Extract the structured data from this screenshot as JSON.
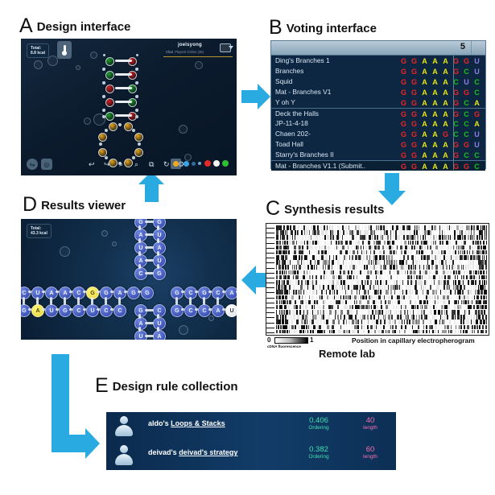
{
  "figure": {
    "panels": [
      {
        "id": "A",
        "letter": "A",
        "title": "Design interface"
      },
      {
        "id": "B",
        "letter": "B",
        "title": "Voting interface"
      },
      {
        "id": "C",
        "letter": "C",
        "title": "Synthesis results"
      },
      {
        "id": "D",
        "letter": "D",
        "title": "Results viewer"
      },
      {
        "id": "E",
        "letter": "E",
        "title": "Design rule collection"
      }
    ],
    "accent_color": "#29ABE2"
  },
  "design_interface": {
    "total_label": "Total:",
    "total_value": "8.8 kcal",
    "username": "joelsyong",
    "chat_label": "Chat",
    "players_online": "Players Online (36)",
    "thermometer_icon": "thermometer-icon",
    "toolbar": {
      "buttons": [
        {
          "name": "swap-button",
          "glyph": "⇋"
        },
        {
          "name": "camera-button",
          "glyph": "◎"
        },
        {
          "name": "undo-button",
          "glyph": "↩"
        },
        {
          "name": "redo-button",
          "glyph": "↪"
        },
        {
          "name": "zoom-in-button",
          "glyph": "⌕"
        },
        {
          "name": "zoom-out-button",
          "glyph": "⌕"
        },
        {
          "name": "screenshot-button",
          "glyph": "⧉"
        },
        {
          "name": "reset-button",
          "glyph": "↻"
        },
        {
          "name": "hint-button",
          "glyph": "⚙"
        }
      ],
      "palette_label": "base-palette"
    },
    "molecule": {
      "stem_pairs": [
        {
          "left": "C",
          "right": "G"
        },
        {
          "left": "C",
          "right": "G"
        },
        {
          "left": "G",
          "right": "C"
        },
        {
          "left": "G",
          "right": "C"
        },
        {
          "left": "C",
          "right": "G"
        }
      ],
      "loop_bases": [
        "A",
        "A",
        "A",
        "A",
        "A",
        "A",
        "A",
        "A"
      ]
    }
  },
  "voting_interface": {
    "column_header": "5",
    "rows": [
      {
        "name": "Ding's Branches 1",
        "seq": [
          "G",
          "G",
          "A",
          "A",
          "A",
          "G",
          "G",
          "U"
        ],
        "group": 1,
        "selected": false
      },
      {
        "name": "Branches",
        "seq": [
          "G",
          "G",
          "A",
          "A",
          "A",
          "G",
          "C",
          "U"
        ],
        "group": 1,
        "selected": false
      },
      {
        "name": "Squid",
        "seq": [
          "G",
          "G",
          "A",
          "A",
          "A",
          "C",
          "U",
          "C"
        ],
        "group": 1,
        "selected": false
      },
      {
        "name": "Mat - Branches V1",
        "seq": [
          "G",
          "G",
          "A",
          "A",
          "A",
          "G",
          "G",
          "C"
        ],
        "group": 1,
        "selected": false
      },
      {
        "name": "Y oh Y",
        "seq": [
          "G",
          "G",
          "A",
          "A",
          "A",
          "G",
          "C",
          "A"
        ],
        "group": 1,
        "selected": false
      },
      {
        "name": "Deck the Halls",
        "seq": [
          "G",
          "G",
          "A",
          "A",
          "A",
          "G",
          "C",
          "G"
        ],
        "group": 2,
        "selected": false
      },
      {
        "name": "JP-11-4-18",
        "seq": [
          "G",
          "G",
          "A",
          "A",
          "A",
          "C",
          "C",
          "A"
        ],
        "group": 2,
        "selected": false
      },
      {
        "name": "Chaen 202-",
        "seq": [
          "G",
          "G",
          "A",
          "A",
          "G",
          "C",
          "C",
          "U"
        ],
        "group": 2,
        "selected": false
      },
      {
        "name": "Toad Hall",
        "seq": [
          "G",
          "G",
          "A",
          "A",
          "A",
          "G",
          "G",
          "U"
        ],
        "group": 2,
        "selected": false
      },
      {
        "name": "Starry's Branches II",
        "seq": [
          "G",
          "G",
          "A",
          "A",
          "A",
          "G",
          "C",
          "C"
        ],
        "group": 2,
        "selected": false
      },
      {
        "name": "Mat - Branches V1.1 (Submit..",
        "seq": [
          "G",
          "G",
          "A",
          "A",
          "A",
          "G",
          "G",
          "C"
        ],
        "group": 3,
        "selected": true
      }
    ],
    "base_colors": {
      "G": "#ef2424",
      "A": "#e8e515",
      "C": "#13c21a",
      "U": "#8f7ce8"
    }
  },
  "synthesis_results": {
    "legend_min": "0",
    "legend_max": "1",
    "legend_caption": "cDNA fluorescence",
    "x_axis_label": "Position in capillary electropherogram",
    "footer": "Remote lab",
    "gel_lanes": 22,
    "colormap": "white-to-black"
  },
  "results_viewer": {
    "total_label": "Total:",
    "total_value": "43.3 kcal",
    "bases": [
      "C",
      "U",
      "A",
      "A",
      "C",
      "G",
      "G",
      "A",
      "G",
      "G",
      "G",
      "C",
      "U",
      "G",
      "C",
      "C",
      "G",
      "C",
      "A",
      "U",
      "U",
      "A",
      "G",
      "C",
      "A",
      "U",
      "A",
      "U",
      "A",
      "U",
      "G",
      "C",
      "G",
      "C",
      "A",
      "U",
      "U",
      "A",
      "U",
      "A"
    ],
    "highlight_color": "#f3e53a",
    "normal_color": "#3b4fb5"
  },
  "design_rules": {
    "rows": [
      {
        "owner": "aldo's",
        "rule": "Loops & Stacks",
        "score": "0.406",
        "score_label": "Ordering",
        "length": "40",
        "length_label": "length",
        "avatar": "user-avatar-icon"
      },
      {
        "owner": "deivad's",
        "rule": "deivad's strategy",
        "score": "0.382",
        "score_label": "Ordering",
        "length": "60",
        "length_label": "length",
        "avatar": "user-avatar-icon"
      }
    ]
  }
}
